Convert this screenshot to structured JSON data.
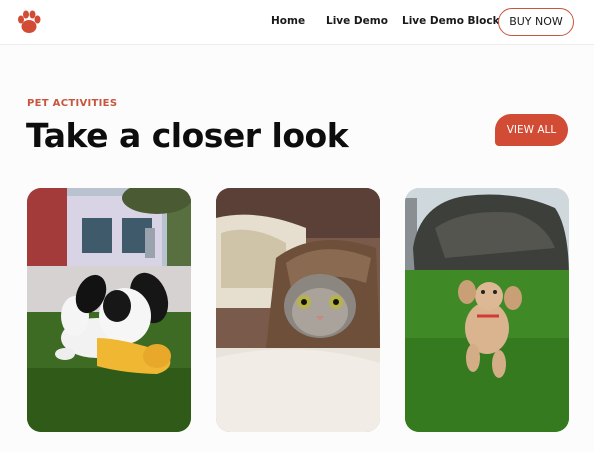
{
  "nav": {
    "home": "Home",
    "live_demo": "Live Demo",
    "live_demo_blocks": "Live Demo Blocks",
    "buy_now": "BUY NOW"
  },
  "section": {
    "eyebrow": "PET ACTIVITIES",
    "heading": "Take a closer look",
    "view_all": "VIEW ALL"
  },
  "cards": [
    {
      "image": "puppy-chewing-toy-photo"
    },
    {
      "image": "kitten-under-blanket-photo"
    },
    {
      "image": "poodle-running-grass-photo"
    }
  ],
  "colors": {
    "accent": "#d24c35",
    "accent_outline": "#c8553d"
  }
}
